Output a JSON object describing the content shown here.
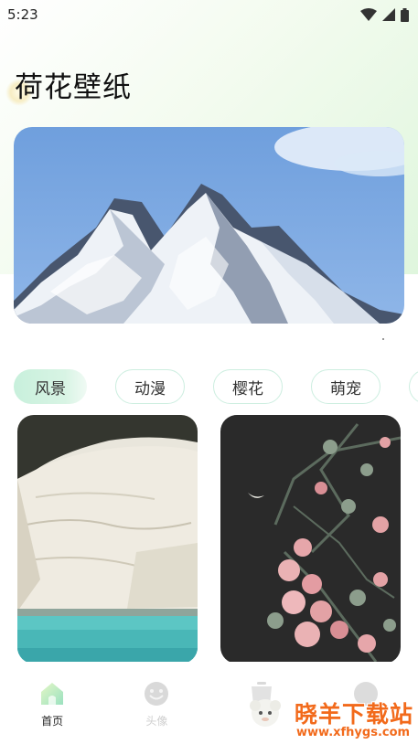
{
  "status_bar": {
    "time": "5:23"
  },
  "header": {
    "title": "荷花壁纸"
  },
  "banner": {
    "image": "snowy-mountain-painting"
  },
  "categories": [
    {
      "label": "风景",
      "active": true
    },
    {
      "label": "动漫",
      "active": false
    },
    {
      "label": "樱花",
      "active": false
    },
    {
      "label": "萌宠",
      "active": false
    }
  ],
  "wallpapers": [
    {
      "image": "white-cliff-sea"
    },
    {
      "image": "pink-blossom-night-moon"
    }
  ],
  "bottom_nav": [
    {
      "label": "首页",
      "icon": "home-icon",
      "active": true
    },
    {
      "label": "头像",
      "icon": "face-icon",
      "active": false
    },
    {
      "label": "",
      "icon": "pot-icon",
      "active": false
    },
    {
      "label": "",
      "icon": "profile-icon",
      "active": false
    }
  ],
  "watermark": {
    "main": "晓羊下载站",
    "url": "www.xfhygs.com"
  },
  "colors": {
    "accent_green": "#c8f0dc",
    "tab_border": "#cdeee0",
    "watermark_orange": "#f26a1b"
  }
}
